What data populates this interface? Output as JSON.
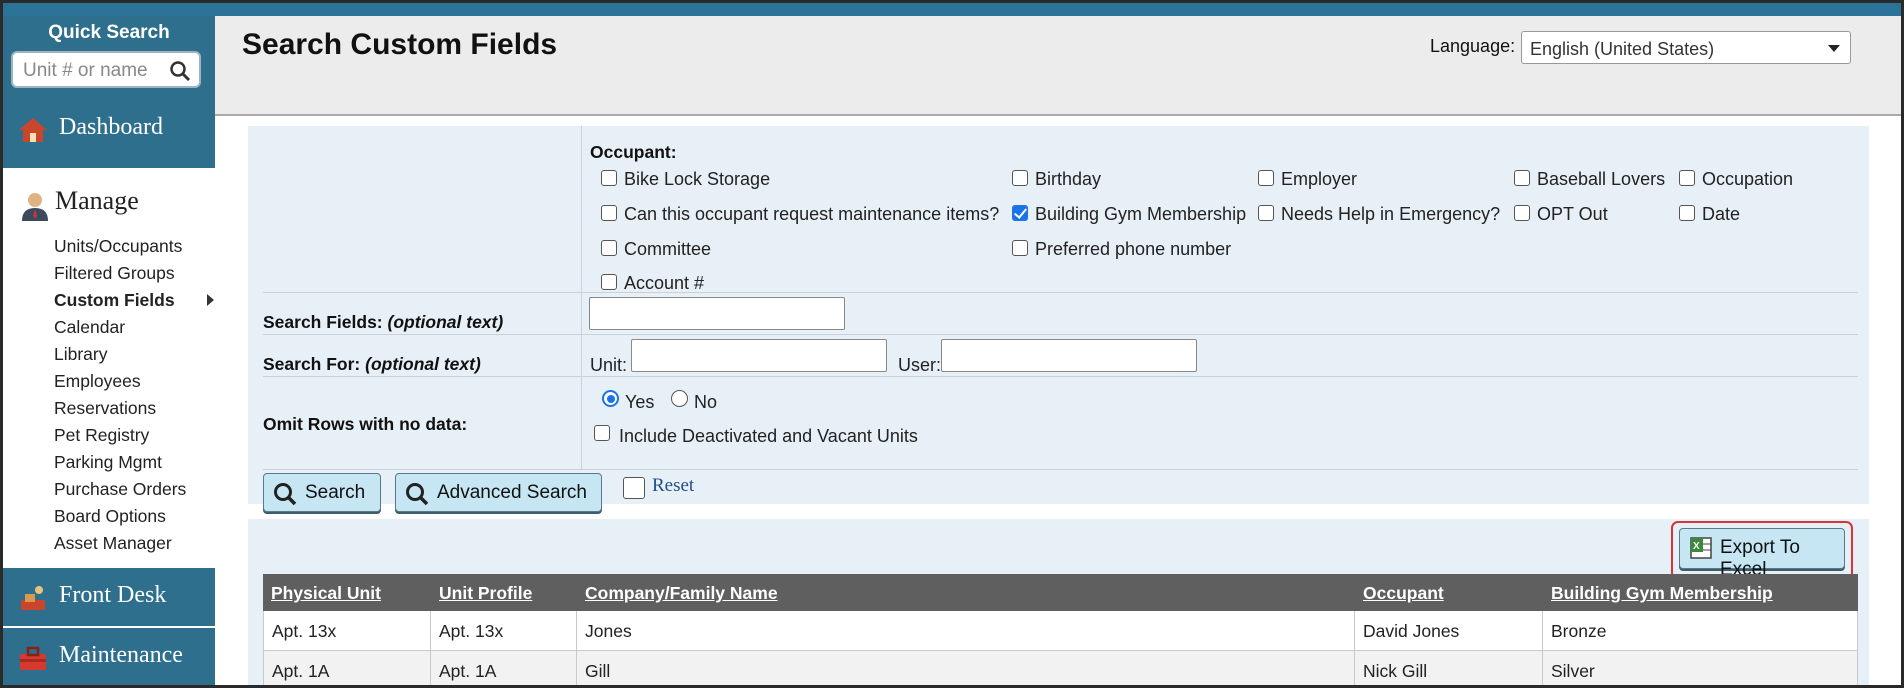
{
  "sidebar": {
    "quick_search_title": "Quick Search",
    "quick_search_placeholder": "Unit # or name",
    "dashboard": "Dashboard",
    "manage": "Manage",
    "manage_items": [
      "Units/Occupants",
      "Filtered Groups",
      "Custom Fields",
      "Calendar",
      "Library",
      "Employees",
      "Reservations",
      "Pet Registry",
      "Parking Mgmt",
      "Purchase Orders",
      "Board Options",
      "Asset Manager"
    ],
    "active_item": "Custom Fields",
    "front_desk": "Front Desk",
    "maintenance": "Maintenance"
  },
  "header": {
    "title": "Search Custom Fields",
    "language_label": "Language:",
    "language_value": "English (United States)"
  },
  "form": {
    "occupant_label": "Occupant:",
    "checkboxes": {
      "bike_lock": {
        "label": "Bike Lock Storage",
        "checked": false
      },
      "can_request": {
        "label": "Can this occupant request maintenance items?",
        "checked": false
      },
      "committee": {
        "label": "Committee",
        "checked": false
      },
      "account": {
        "label": "Account #",
        "checked": false
      },
      "birthday": {
        "label": "Birthday",
        "checked": false
      },
      "gym": {
        "label": "Building Gym Membership",
        "checked": true
      },
      "phone": {
        "label": "Preferred phone number",
        "checked": false
      },
      "employer": {
        "label": "Employer",
        "checked": false
      },
      "needs_help": {
        "label": "Needs Help in Emergency?",
        "checked": false
      },
      "baseball": {
        "label": "Baseball Lovers",
        "checked": false
      },
      "opt_out": {
        "label": "OPT Out",
        "checked": false
      },
      "occupation": {
        "label": "Occupation",
        "checked": false
      },
      "date": {
        "label": "Date",
        "checked": false
      }
    },
    "search_fields_label": "Search Fields:",
    "optional_text": "(optional text)",
    "search_fields_value": "",
    "search_for_label": "Search For:",
    "unit_label": "Unit:",
    "unit_value": "",
    "user_label": "User:",
    "user_value": "",
    "omit_label": "Omit Rows with no data:",
    "omit_yes": "Yes",
    "omit_no": "No",
    "omit_selected": "Yes",
    "include_deactivated": "Include Deactivated and Vacant Units",
    "search_button": "Search",
    "advanced_button": "Advanced Search",
    "reset": "Reset"
  },
  "results": {
    "export_button": "Export To Excel",
    "columns": [
      "Physical Unit",
      "Unit Profile",
      "Company/Family Name",
      "Occupant",
      "Building Gym Membership"
    ],
    "rows": [
      [
        "Apt. 13x",
        "Apt. 13x",
        "Jones",
        "David Jones",
        "Bronze"
      ],
      [
        "Apt. 1A",
        "Apt. 1A",
        "Gill",
        "Nick Gill",
        "Silver"
      ]
    ]
  },
  "colors": {
    "sidebar_teal": "#2e6f8e",
    "form_bg": "#e8f0f7",
    "button_bg": "#c6e6f3",
    "table_header": "#5f5f5f",
    "highlight": "#d9343a"
  }
}
